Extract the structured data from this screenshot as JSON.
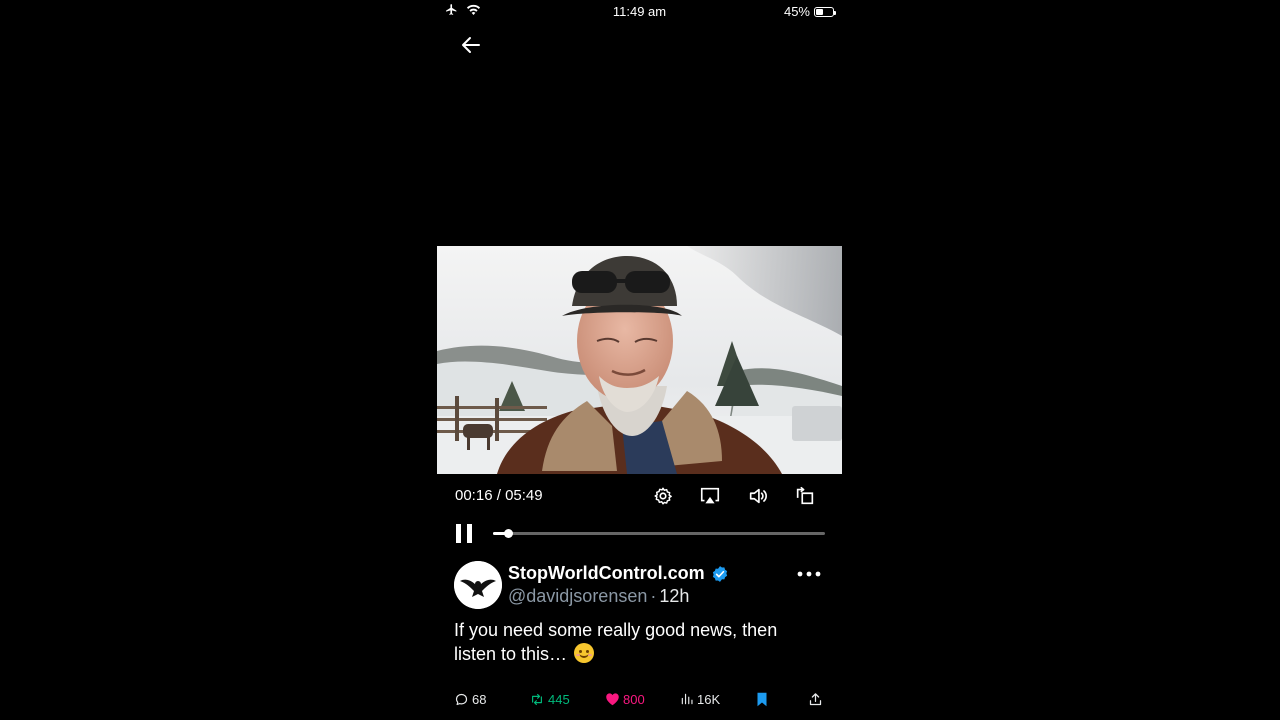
{
  "status_bar": {
    "time": "11:49 am",
    "battery_percent": "45%",
    "battery_level": 0.45,
    "icons": [
      "airplane-icon",
      "wifi-icon",
      "battery-icon"
    ]
  },
  "navigation": {
    "back_icon": "arrow-left-icon"
  },
  "player": {
    "current_time": "00:16",
    "separator": " / ",
    "duration": "05:49",
    "progress": 0.046,
    "controls": [
      "settings-icon",
      "airplay-icon",
      "volume-icon",
      "rotate-icon"
    ],
    "state_icon": "pause-icon"
  },
  "tweet": {
    "author_name": "StopWorldControl.com",
    "handle": "@davidjsorensen",
    "dot": "·",
    "age": "12h",
    "text": "If you need some really good news, then listen to this…",
    "emoji": "smiling-face-emoji",
    "verified": true
  },
  "actions": {
    "replies": "68",
    "reposts": "445",
    "likes": "800",
    "views": "16K"
  },
  "colors": {
    "background": "#000000",
    "secondary_text": "#8b98a5",
    "verified_blue": "#1d9bf0",
    "repost_green": "#00ba7c",
    "like_pink": "#f91880",
    "bookmark_blue": "#1d9bf0"
  }
}
